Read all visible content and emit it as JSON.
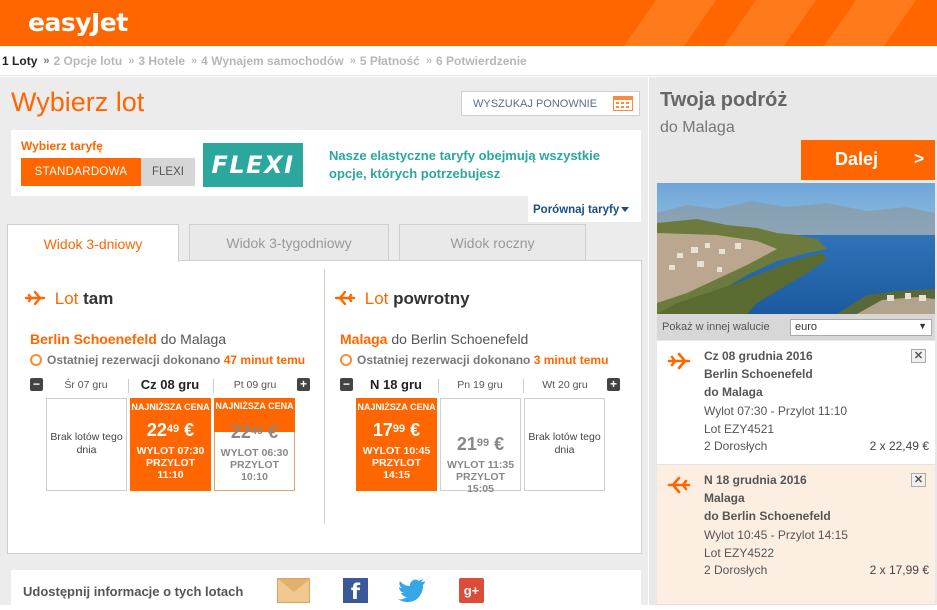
{
  "brand": {
    "name": "easyJet"
  },
  "steps": [
    {
      "num": "1",
      "label": "Loty"
    },
    {
      "num": "2",
      "label": "Opcje lotu"
    },
    {
      "num": "3",
      "label": "Hotele"
    },
    {
      "num": "4",
      "label": "Wynajem samochodów"
    },
    {
      "num": "5",
      "label": "Płatność"
    },
    {
      "num": "6",
      "label": "Potwierdzenie"
    }
  ],
  "main": {
    "title": "Wybierz lot",
    "search_again": "WYSZUKAJ PONOWNIE",
    "fare": {
      "label": "Wybierz taryfę",
      "standard": "STANDARDOWA",
      "flexi": "FLEXI",
      "badge": "FLEXI",
      "description": "Nasze elastyczne taryfy obejmują wszystkie opcje, których potrzebujesz"
    },
    "compare": "Porównaj taryfy",
    "tabs": [
      "Widok 3-dniowy",
      "Widok 3-tygodniowy",
      "Widok roczny"
    ]
  },
  "outbound": {
    "head_prefix": "Lot",
    "head_bold": "tam",
    "origin": "Berlin Schoenefeld",
    "to_text": "do Malaga",
    "booked_prefix": "Ostatniej rezerwacji dokonano",
    "booked_ago": "47 minut temu",
    "minus": "−",
    "plus": "+",
    "days": [
      {
        "name": "Śr 07 gru"
      },
      {
        "name": "Cz 08 gru"
      },
      {
        "name": "Pt 09 gru"
      }
    ],
    "cells": [
      {
        "text": "Brak lotów tego dnia"
      },
      {
        "badge": "NAJNIŻSZA CENA",
        "price_main": "22",
        "price_cents": "49",
        "currency": "€",
        "dep": "WYLOT 07:30",
        "arr_label": "PRZYLOT",
        "arr": "11:10"
      },
      {
        "badge": "NAJNIŻSZA CENA",
        "price_main": "22",
        "price_cents": "49",
        "currency": "€",
        "dep": "WYLOT 06:30",
        "arr_label": "PRZYLOT",
        "arr": "10:10"
      }
    ]
  },
  "return": {
    "head_prefix": "Lot",
    "head_bold": "powrotny",
    "origin": "Malaga",
    "to_text": "do Berlin Schoenefeld",
    "booked_prefix": "Ostatniej rezerwacji dokonano",
    "booked_ago": "3 minut temu",
    "minus": "−",
    "plus": "+",
    "days": [
      {
        "name": "N 18 gru"
      },
      {
        "name": "Pn 19 gru"
      },
      {
        "name": "Wt 20 gru"
      }
    ],
    "cells": [
      {
        "badge": "NAJNIŻSZA CENA",
        "price_main": "17",
        "price_cents": "99",
        "currency": "€",
        "dep": "WYLOT 10:45",
        "arr_label": "PRZYLOT",
        "arr": "14:15"
      },
      {
        "price_main": "21",
        "price_cents": "99",
        "currency": "€",
        "dep": "WYLOT 11:35",
        "arr_label": "PRZYLOT",
        "arr": "15:05"
      },
      {
        "text": "Brak lotów tego dnia"
      }
    ]
  },
  "share": {
    "label": "Udostępnij informacje o tych lotach"
  },
  "sidebar": {
    "title": "Twoja podróż",
    "subtitle": "do Malaga",
    "next": "Dalej",
    "next_arrow": ">",
    "currency_label": "Pokaż w innej walucie",
    "currency_value": "euro",
    "trips": [
      {
        "date": "Cz 08 grudnia 2016",
        "from": "Berlin Schoenefeld",
        "to": "do Malaga",
        "times": "Wylot 07:30 - Przylot 11:10",
        "flight": "Lot EZY4521",
        "pax": "2 Dorosłych",
        "total": "2 x 22,49 €"
      },
      {
        "date": "N 18 grudnia 2016",
        "from": "Malaga",
        "to": "do Berlin Schoenefeld",
        "times": "Wylot 10:45 - Przylot 14:15",
        "flight": "Lot EZY4522",
        "pax": "2 Dorosłych",
        "total": "2 x 17,99 €"
      }
    ]
  },
  "colors": {
    "brand": "#ff6600",
    "flexi": "#2ba79d",
    "link": "#1a4e8a"
  }
}
